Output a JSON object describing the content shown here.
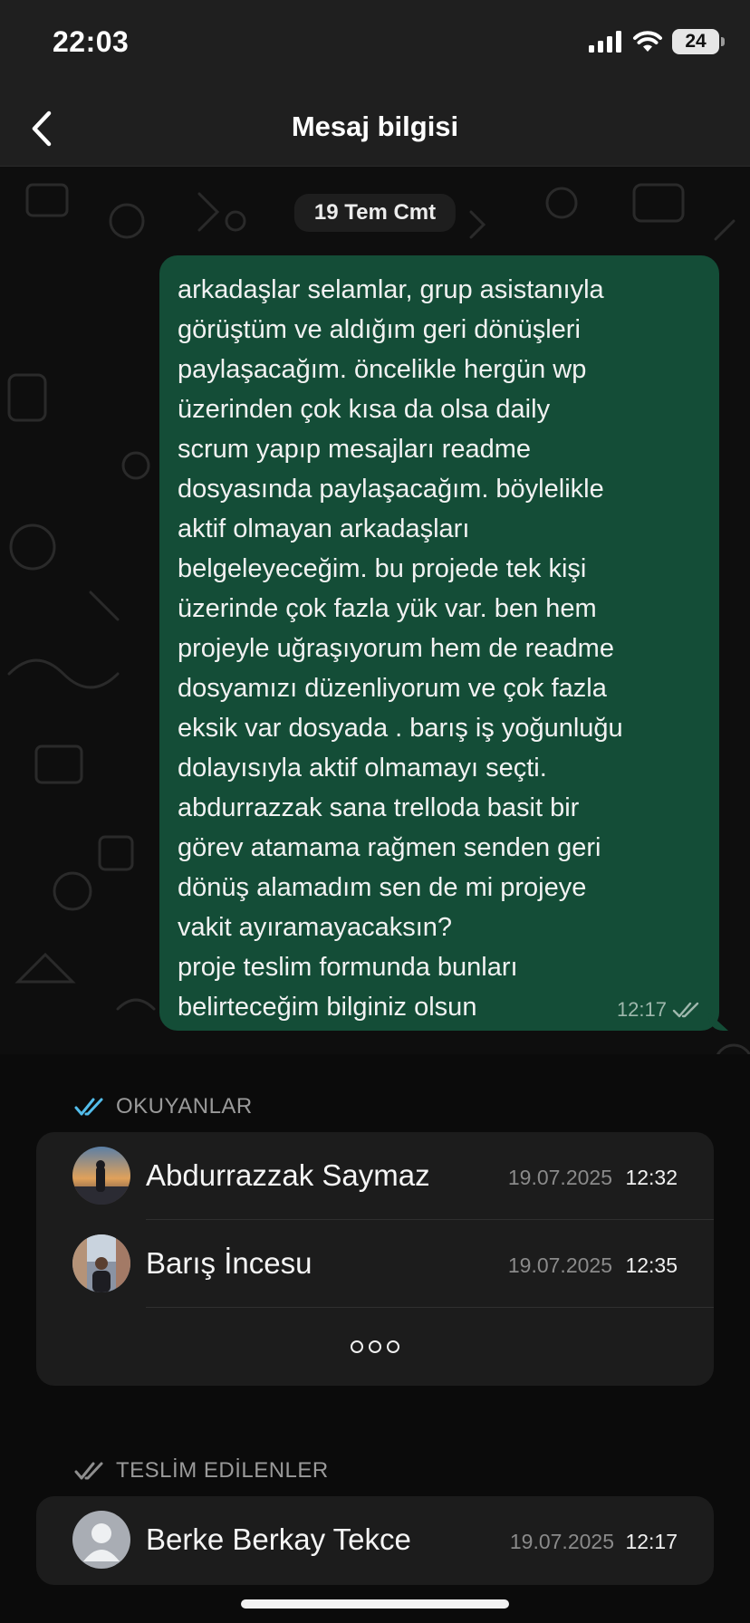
{
  "status_bar": {
    "time": "22:03",
    "battery": "24"
  },
  "header": {
    "title": "Mesaj bilgisi"
  },
  "chat": {
    "date_chip": "19 Tem Cmt",
    "message": {
      "text": "arkadaşlar selamlar, grup asistanıyla\ngörüştüm ve aldığım geri dönüşleri\npaylaşacağım. öncelikle hergün wp\nüzerinden çok kısa da olsa daily\nscrum yapıp mesajları readme\ndosyasında paylaşacağım. böylelikle\naktif olmayan arkadaşları\nbelgeleyeceğim. bu projede tek kişi\nüzerinde çok fazla yük var. ben hem\nprojeyle uğraşıyorum hem de readme\ndosyamızı düzenliyorum ve çok fazla\neksik var dosyada . barış iş yoğunluğu\ndolayısıyla aktif olmamayı seçti.\nabdurrazzak sana trelloda basit bir\ngörev atamama rağmen senden geri\ndönüş alamadım sen de mi projeye\nvakit ayıramayacaksın?\nproje teslim formunda bunları\nbelirteceğim bilginiz olsun",
      "time": "12:17"
    }
  },
  "read_section": {
    "label": "OKUYANLAR",
    "readers": [
      {
        "name": "Abdurrazzak Saymaz",
        "date": "19.07.2025",
        "time": "12:32"
      },
      {
        "name": "Barış İncesu",
        "date": "19.07.2025",
        "time": "12:35"
      }
    ]
  },
  "delivered_section": {
    "label": "TESLİM EDİLENLER",
    "recipients": [
      {
        "name": "Berke Berkay Tekce",
        "date": "19.07.2025",
        "time": "12:17"
      }
    ]
  },
  "colors": {
    "bubble": "#144d37",
    "read_ticks": "#53bdeb",
    "delivered_ticks": "#8e8e8e",
    "header": "#1f1f1f"
  },
  "icons": [
    "back-chevron-icon",
    "cellular-signal-icon",
    "wifi-icon",
    "battery-icon",
    "double-check-icon",
    "more-dots-icon",
    "default-avatar-icon"
  ]
}
